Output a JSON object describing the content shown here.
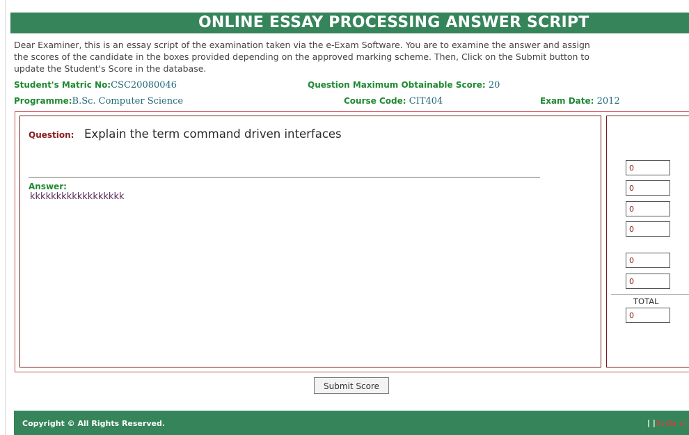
{
  "header": {
    "title": "ONLINE ESSAY PROCESSING ANSWER SCRIPT"
  },
  "intro": {
    "line1": "Dear Examiner, this is an essay script of the examination taken via the e-Exam Software. You are to examine the answer and assign",
    "line2": "the scores of the candidate in the boxes provided depending on the approved marking scheme. Then, Click on the Submit button to",
    "line3": "update the Student's Score in the database."
  },
  "meta": {
    "matric_label": "Student's Matric No:",
    "matric_value": "CSC20080046",
    "max_score_label": "Question Maximum Obtainable Score:",
    "max_score_value": "20",
    "programme_label": "Programme:",
    "programme_value": "B.Sc. Computer Science",
    "course_label": "Course Code:",
    "course_value": "CIT404",
    "exam_date_label": "Exam Date:",
    "exam_date_value": "2012"
  },
  "question": {
    "label": "Question:",
    "text": "Explain the term command driven interfaces"
  },
  "answer": {
    "label": "Answer:",
    "text": "kkkkkkkkkkkkkkkkkk"
  },
  "scores": {
    "inputs": [
      "0",
      "0",
      "0",
      "0",
      "0",
      "0"
    ],
    "total_label": "TOTAL",
    "total_value": "0"
  },
  "submit": {
    "label": "Submit Score"
  },
  "footer": {
    "copyright": "Copyright © All Rights Reserved.",
    "separator": "| |",
    "link": "Xvilla ©"
  },
  "colors": {
    "accent_green": "#36855a",
    "frame_red": "#7a1a1a",
    "label_green": "#1e8a32"
  }
}
